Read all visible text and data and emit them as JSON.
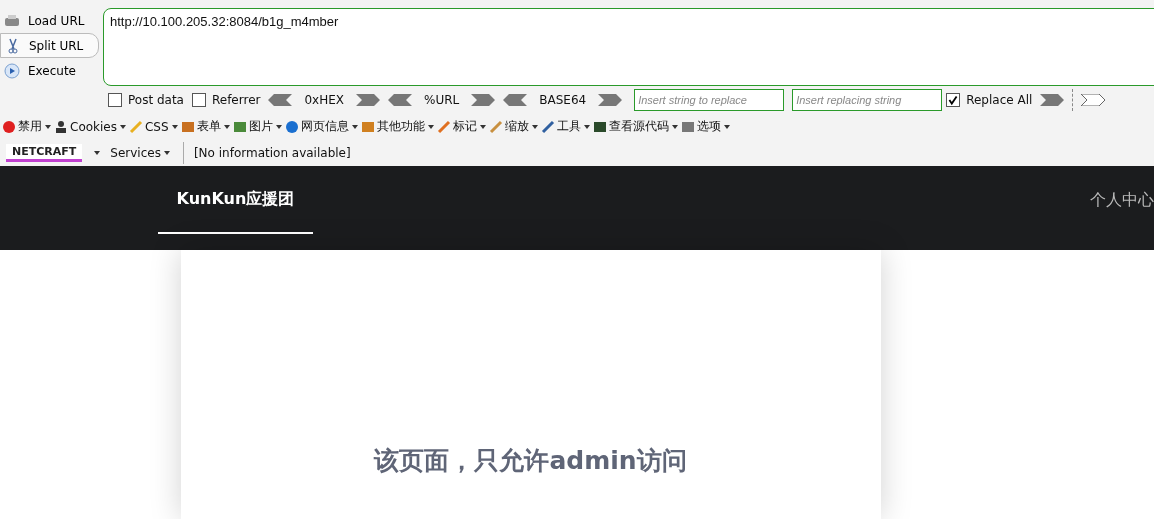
{
  "url_actions": [
    {
      "label": "Load URL"
    },
    {
      "label": "Split URL"
    },
    {
      "label": "Execute"
    }
  ],
  "url": "http://10.100.205.32:8084/b1g_m4mber",
  "options": [
    {
      "label": "Post data",
      "checked": false
    },
    {
      "label": "Referrer",
      "checked": false
    }
  ],
  "encoders": [
    {
      "label": "0xHEX"
    },
    {
      "label": "%URL"
    },
    {
      "label": "BASE64"
    }
  ],
  "replace": {
    "find_placeholder": "Insert string to replace",
    "replace_placeholder": "Insert replacing string",
    "replace_all": {
      "label": "Replace All",
      "checked": true
    }
  },
  "toolbar": [
    {
      "label": "禁用"
    },
    {
      "label": "Cookies"
    },
    {
      "label": "CSS"
    },
    {
      "label": "表单"
    },
    {
      "label": "图片"
    },
    {
      "label": "网页信息"
    },
    {
      "label": "其他功能"
    },
    {
      "label": "标记"
    },
    {
      "label": "缩放"
    },
    {
      "label": "工具"
    },
    {
      "label": "查看源代码"
    },
    {
      "label": "选项"
    }
  ],
  "netcraft": {
    "logo": "NETCRAFT",
    "services": "Services",
    "info": "[No information available]"
  },
  "nav": {
    "tabs": [
      {
        "label": "KunKun应援团",
        "selected": true
      }
    ],
    "right_link": "个人中心"
  },
  "message": "该页面，只允许admin访问"
}
